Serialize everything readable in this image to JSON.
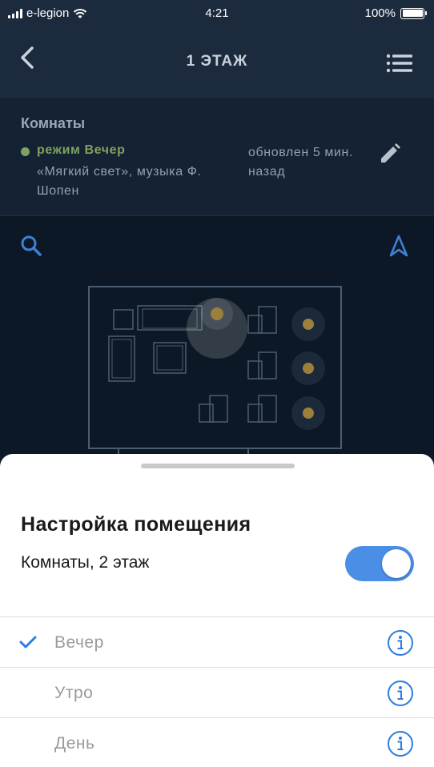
{
  "status_bar": {
    "carrier": "e-legion",
    "time": "4:21",
    "battery": "100%"
  },
  "nav": {
    "title": "1 ЭТАЖ",
    "back_icon": "chevron-left-icon",
    "menu_icon": "list-menu-icon"
  },
  "rooms": {
    "title": "Комнаты",
    "mode_name": "режим Вечер",
    "mode_description": "«Мягкий свет», музыка Ф. Шопен",
    "updated": "обновлен 5 мин. назад",
    "edit_icon": "pencil-icon"
  },
  "map": {
    "search_icon": "search-icon",
    "location_icon": "navigation-arrow-icon"
  },
  "sheet": {
    "title": "Настройка помещения",
    "toggle_label": "Комнаты, 2 этаж",
    "toggle_on": true,
    "items": [
      {
        "label": "Вечер",
        "selected": true
      },
      {
        "label": "Утро",
        "selected": false
      },
      {
        "label": "День",
        "selected": false
      }
    ]
  },
  "colors": {
    "accent": "#4a8ee6",
    "mode_green": "#7fa35e",
    "header_bg": "#1b2a3d",
    "map_bg": "#0d1826"
  }
}
